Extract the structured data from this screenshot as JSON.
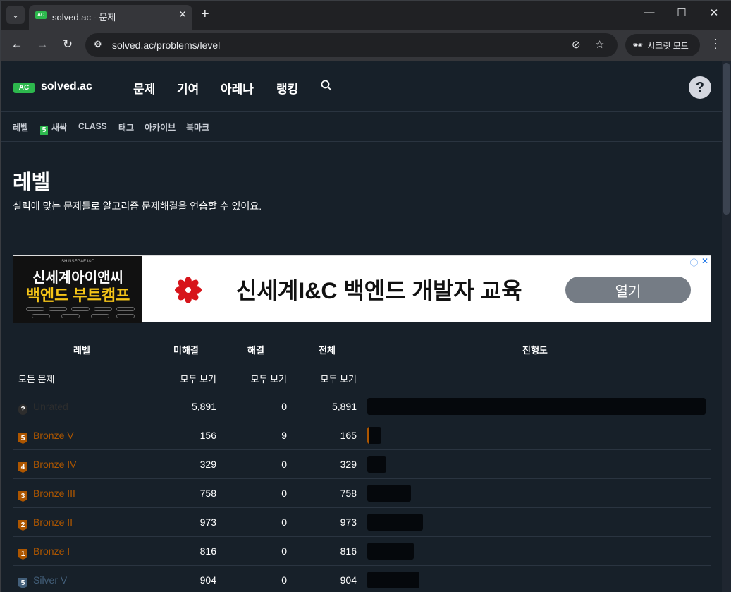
{
  "browser": {
    "tab_title": "solved.ac - 문제",
    "favicon_text": "AC",
    "url": "solved.ac/problems/level",
    "incognito_label": "시크릿 모드"
  },
  "site": {
    "logo_badge": "AC",
    "logo_text": "solved.ac",
    "nav": [
      "문제",
      "기여",
      "아레나",
      "랭킹"
    ],
    "help": "?",
    "subnav": {
      "level": "레벨",
      "new_badge": "5",
      "new": "새싹",
      "class": "CLASS",
      "tag": "태그",
      "archive": "아카이브",
      "bookmark": "북마크"
    }
  },
  "page": {
    "title": "레벨",
    "description": "실력에 맞는 문제들로 알고리즘 문제해결을 연습할 수 있어요."
  },
  "ad": {
    "image_top": "SHINSEGAE I&C",
    "image_line1": "신세계아이앤씨",
    "image_line2": "백엔드 부트캠프",
    "headline": "신세계I&C 백엔드 개발자 교육",
    "button": "열기",
    "info": "ⓘ",
    "close": "✕"
  },
  "table": {
    "headers": {
      "level": "레벨",
      "unsolved": "미해결",
      "solved": "해결",
      "total": "전체",
      "progress": "진행도"
    },
    "all_row": {
      "label": "모든 문제",
      "unsolved": "모두 보기",
      "solved": "모두 보기",
      "total": "모두 보기"
    },
    "rows": [
      {
        "tier_icon": "?",
        "name": "Unrated",
        "color": "#2d2d2d",
        "unsolved": "5,891",
        "solved": "0",
        "total": "5,891",
        "progress": 0
      },
      {
        "tier_icon": "5",
        "name": "Bronze V",
        "color": "#ad5600",
        "unsolved": "156",
        "solved": "9",
        "total": "165",
        "progress": 0.055
      },
      {
        "tier_icon": "4",
        "name": "Bronze IV",
        "color": "#ad5600",
        "unsolved": "329",
        "solved": "0",
        "total": "329",
        "progress": 0
      },
      {
        "tier_icon": "3",
        "name": "Bronze III",
        "color": "#ad5600",
        "unsolved": "758",
        "solved": "0",
        "total": "758",
        "progress": 0
      },
      {
        "tier_icon": "2",
        "name": "Bronze II",
        "color": "#ad5600",
        "unsolved": "973",
        "solved": "0",
        "total": "973",
        "progress": 0
      },
      {
        "tier_icon": "1",
        "name": "Bronze I",
        "color": "#ad5600",
        "unsolved": "816",
        "solved": "0",
        "total": "816",
        "progress": 0
      },
      {
        "tier_icon": "5",
        "name": "Silver V",
        "color": "#435f7a",
        "unsolved": "904",
        "solved": "0",
        "total": "904",
        "progress": 0
      }
    ]
  }
}
